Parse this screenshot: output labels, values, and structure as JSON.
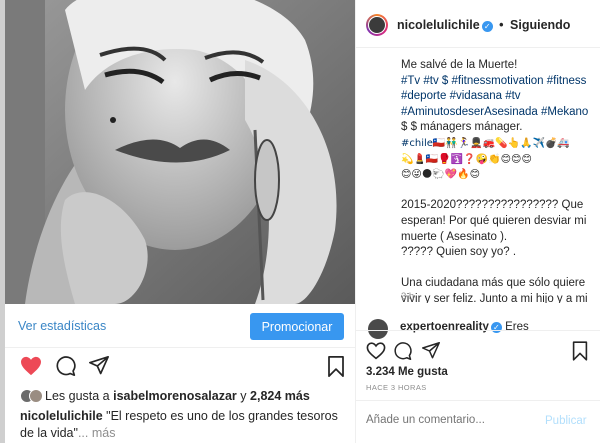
{
  "left": {
    "stats_link": "Ver estadísticas",
    "promote_button": "Promocionar",
    "likes": {
      "prefix": "Les gusta a",
      "user": "isabelmorenosalazar",
      "connector": "y",
      "count": "2,824 más"
    },
    "caption": {
      "user": "nicolelulichile",
      "text": "\"El respeto es uno de los grandes tesoros de la vida\"",
      "more": "... más"
    }
  },
  "right": {
    "username": "nicolelulichile",
    "separator": "•",
    "follow_state": "Siguiendo",
    "post_lines": [
      "Me salvé de la Muerte!",
      "#Tv #tv $ #fitnessmotivation #fitness",
      "#deporte #vidasana #tv",
      "#AminutosdeserAsesinada #Mekano",
      "$ $ mánagers mánager.",
      "#chile🇨🇱👬🏃‍♀️💂‍♂️🚒💊👆🙏✈️💣🚑",
      "💫💄🇨🇱🥊🛐❓🤪👏😊😊😊",
      "😊😜🌑🐑💖🔥😊"
    ],
    "post_paragraph_1": "2015-2020???????????????? Que esperan! Por qué quieren desviar mi muerte ( Asesinato ).",
    "post_question": "????? Quien soy yo? .",
    "post_paragraph_2": "Una ciudadana más que sólo quiere vivir y ser feliz. Junto a mi hijo y a mi gente...",
    "time_small": "3 h",
    "comment": {
      "user": "expertoenreality",
      "text": "Eres"
    },
    "likes": "3.234 Me gusta",
    "time_ago": "HACE 3 HORAS",
    "add_comment_placeholder": "Añade un comentario...",
    "publish_label": "Publicar"
  },
  "colors": {
    "accent": "#3897f0",
    "link": "#003569",
    "stats_link": "#3a86c6",
    "like_red": "#ed4956",
    "muted": "#8e8e8e"
  },
  "icons": [
    "heart-icon",
    "comment-icon",
    "share-icon",
    "bookmark-icon",
    "verified-icon"
  ]
}
